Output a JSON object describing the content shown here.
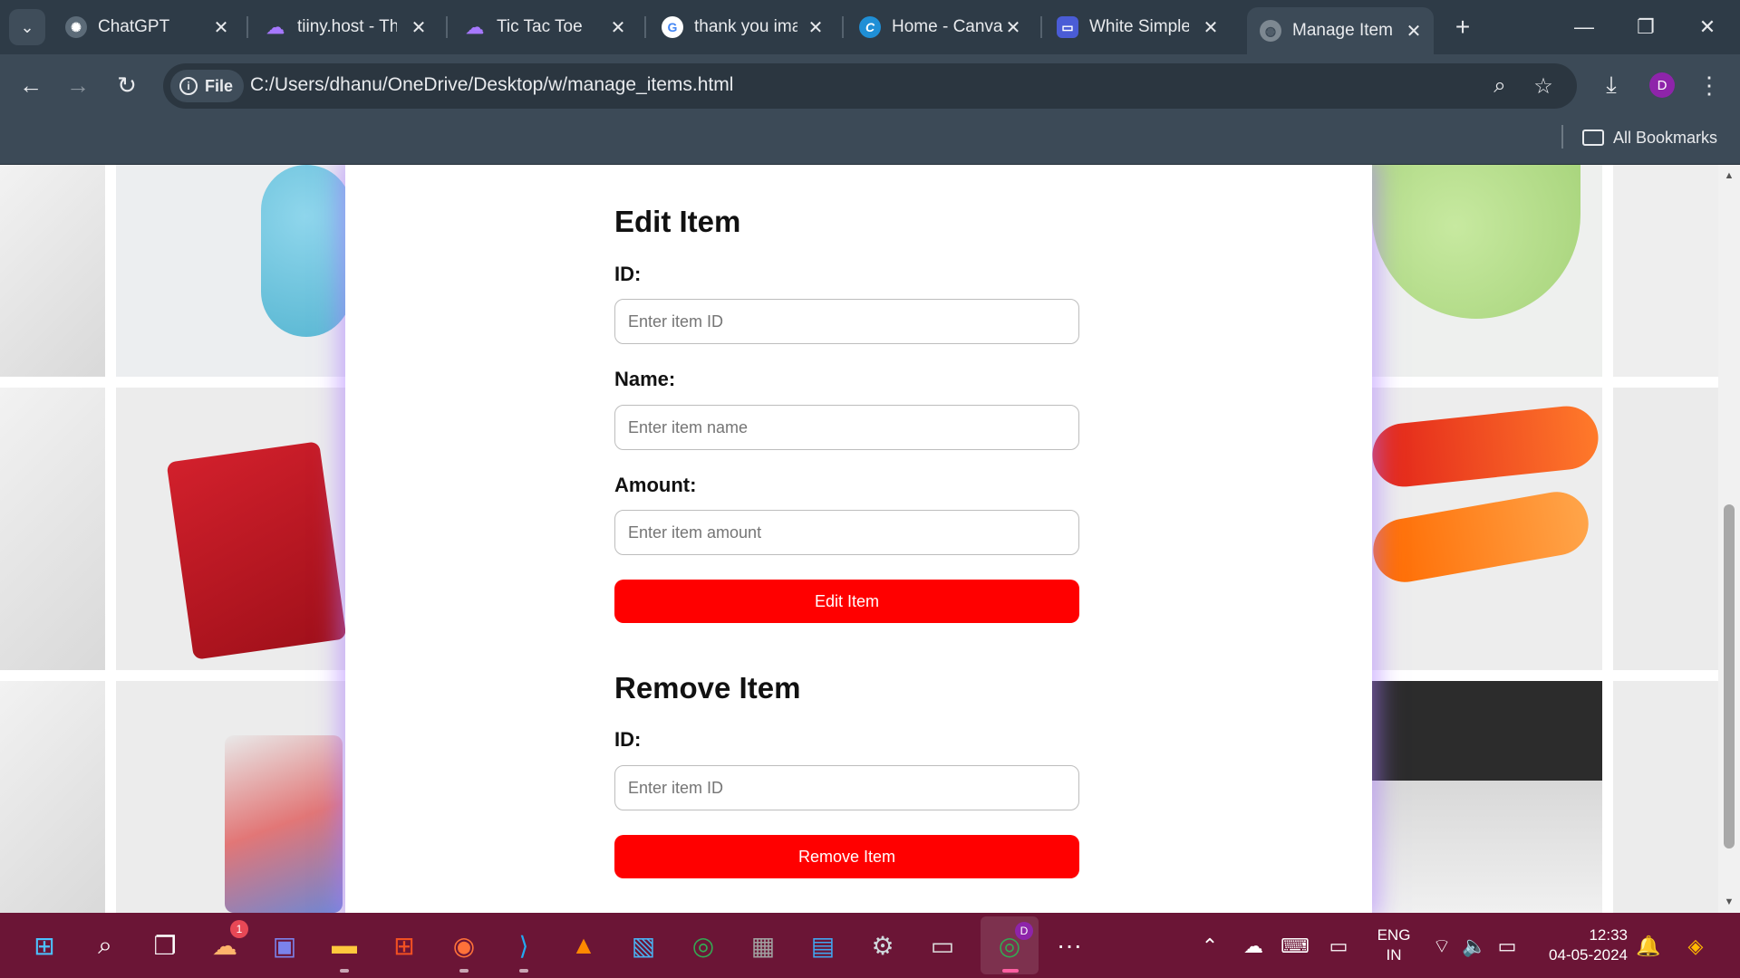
{
  "browser": {
    "tabs": [
      {
        "title": "ChatGPT",
        "icon": "chatgpt-icon",
        "active": false
      },
      {
        "title": "tiiny.host - Th",
        "icon": "tiiny-icon",
        "active": false
      },
      {
        "title": "Tic Tac Toe",
        "icon": "tiiny-icon",
        "active": false
      },
      {
        "title": "thank you ima",
        "icon": "google-icon",
        "active": false
      },
      {
        "title": "Home - Canva",
        "icon": "canva-icon",
        "active": false
      },
      {
        "title": "White Simple",
        "icon": "app-icon",
        "active": false
      },
      {
        "title": "Manage Items",
        "icon": "globe-icon",
        "active": true
      }
    ],
    "omnibox": {
      "chip_label": "File",
      "url": "C:/Users/dhanu/OneDrive/Desktop/w/manage_items.html"
    },
    "profile_initial": "D",
    "bookmarks": {
      "all_label": "All Bookmarks"
    }
  },
  "page": {
    "edit": {
      "heading": "Edit Item",
      "id_label": "ID:",
      "id_placeholder": "Enter item ID",
      "name_label": "Name:",
      "name_placeholder": "Enter item name",
      "amount_label": "Amount:",
      "amount_placeholder": "Enter item amount",
      "button": "Edit Item"
    },
    "remove": {
      "heading": "Remove Item",
      "id_label": "ID:",
      "id_placeholder": "Enter item ID",
      "button": "Remove Item"
    },
    "colors": {
      "button": "#ff0000",
      "glow": "#aa78ff"
    }
  },
  "taskbar": {
    "apps": [
      "start-icon",
      "search-icon",
      "task-view-icon",
      "widgets-icon",
      "meet-icon",
      "file-explorer-icon",
      "store-icon",
      "firefox-icon",
      "vscode-icon",
      "vlc-icon",
      "photos-icon",
      "chrome-icon",
      "calculator-icon",
      "notepad-icon",
      "settings-icon",
      "terminal-icon",
      "chrome-profile-icon",
      "more-icon"
    ],
    "widgets_badge": "1",
    "chrome_profile_badge": "D",
    "lang_top": "ENG",
    "lang_bottom": "IN",
    "time": "12:33",
    "date": "04-05-2024"
  }
}
